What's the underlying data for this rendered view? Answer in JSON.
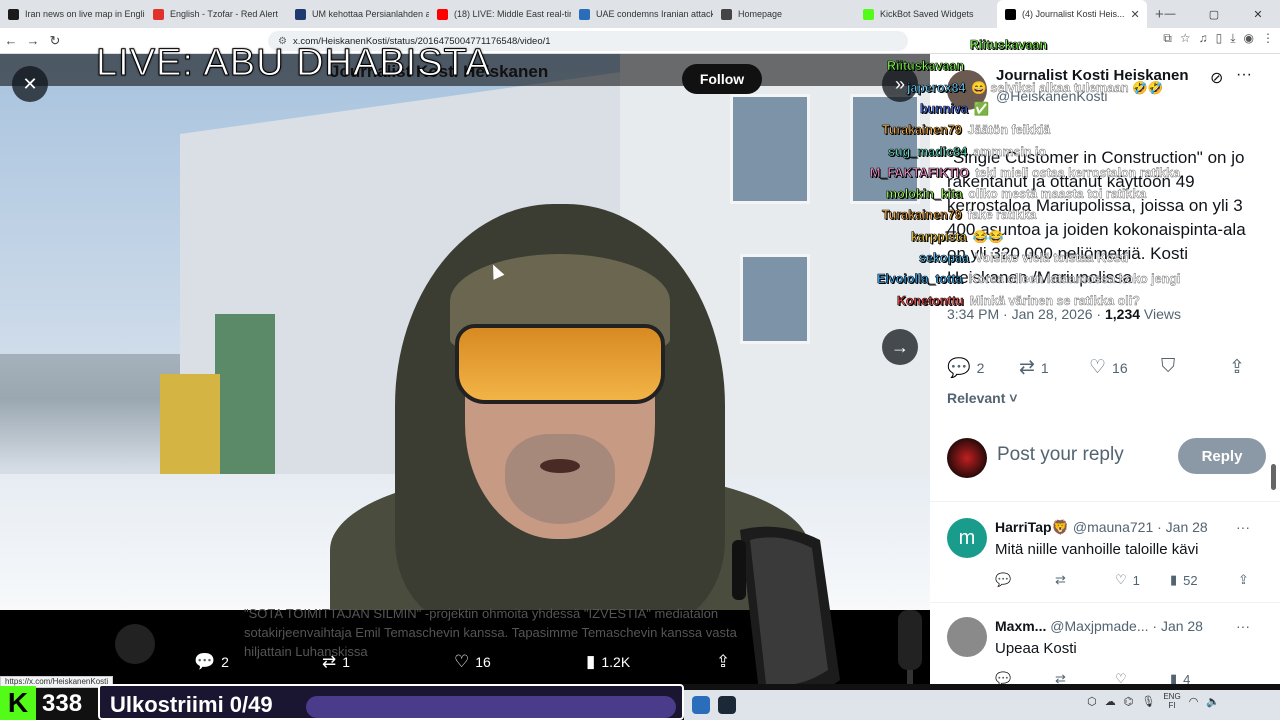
{
  "browser": {
    "tabs": [
      {
        "title": "Iran news on live map in Englis",
        "color": "#1a1a1a"
      },
      {
        "title": "English - Tzofar - Red Alert",
        "color": "#e0312c"
      },
      {
        "title": "UM kehottaa Persianlahden al...",
        "color": "#1f3a6e"
      },
      {
        "title": "(18) LIVE: Middle East real-time",
        "color": "#ff0000"
      },
      {
        "title": "UAE condemns Iranian attacks",
        "color": "#2a6ebb"
      },
      {
        "title": "Homepage",
        "color": "#444444"
      },
      {
        "title": "KickBot Saved Widgets",
        "color": "#53fc18"
      },
      {
        "title": "(4) Journalist Kosti Heis...",
        "color": "#000000"
      }
    ],
    "url": "x.com/HeiskanenKosti/status/2016475004771176548/video/1",
    "status_url": "https://x.com/HeiskanenKosti"
  },
  "video": {
    "overlay_title": "LIVE: ABU DHABISTA",
    "ghost_author": "Journalist Kosti Heiskanen",
    "ghost_follow": "Follow",
    "caption": "\"SOTA TOIMITTAJAN SILMIN\" -projektin ohmoita yhdessä \"IZVESTIA\" mediatalon sotakirjeenvaihtaja Emil Temaschevin kanssa. Tapasimme Temaschevin kanssa vasta hiljattain Luhanskissa",
    "actions": {
      "replies": "2",
      "reposts": "1",
      "likes": "16",
      "views": "1.2K"
    }
  },
  "tweet": {
    "author_name": "Journalist Kosti Heiskanen",
    "author_handle": "@HeiskanenKosti",
    "text": "\"Single Customer in Construction\" on jo rakentanut ja ottanut käyttöön 49 kerrostaloa Mariupolissa, joissa on yli 3 400 asuntoa ja joiden kokonaispinta-ala on yli 320 000 neliömetriä. Kosti Heiskanen /Mariupolissa",
    "time": "3:34 PM · Jan 28, 2026 · ",
    "views": "1,234",
    "views_label": " Views",
    "actions": {
      "replies": "2",
      "reposts": "1",
      "likes": "16"
    },
    "sort_label": "Relevant",
    "reply_placeholder": "Post your reply",
    "reply_button": "Reply"
  },
  "replies": [
    {
      "name": "HarriTap🦁",
      "handle": "@mauna721 · Jan 28",
      "text": "Mitä niille vanhoille taloille kävi",
      "avatar_letter": "m",
      "avatar_color": "#1a9c8c",
      "reposts": "",
      "likes": "1",
      "views": "52"
    },
    {
      "name": "Maxm...",
      "handle": "@Maxjpmade... · Jan 28",
      "text": "Upeaa Kosti",
      "avatar_letter": "",
      "avatar_color": "#8a8a8a",
      "reposts": "",
      "likes": "",
      "views": "4"
    }
  ],
  "chat": [
    {
      "user": "Riituskavaan",
      "msg": "",
      "color": "#7cff4a"
    },
    {
      "user": "Riituskavaan",
      "msg": "",
      "color": "#7cff4a"
    },
    {
      "user": "japerox84",
      "msg": "😄 selviksi alkaa tulemaan 🤣🤣",
      "color": "#6fd0ff"
    },
    {
      "user": "bunniva",
      "msg": "✅",
      "color": "#4f7bff"
    },
    {
      "user": "Turakainen79",
      "msg": "Jäätön feikkiä",
      "color": "#ffb347"
    },
    {
      "user": "sug_madic84",
      "msg": "ammmsin io",
      "color": "#66e0c2"
    },
    {
      "user": "M_FAKTAFIKTIO",
      "msg": "teki mieli ostaa kerrostalon ratikka",
      "color": "#ff9ad5"
    },
    {
      "user": "molokin_kita",
      "msg": "oliko mestä maasta toi ratikka",
      "color": "#9cff57"
    },
    {
      "user": "Turakainen79",
      "msg": "fake ratikka",
      "color": "#ffb347"
    },
    {
      "user": "karppista",
      "msg": "😂😂",
      "color": "#ffd84d"
    },
    {
      "user": "sekopaa",
      "msg": "Voisiko vielä toistaa Kosti",
      "color": "#5ec8ff"
    },
    {
      "user": "Elvoiolla_totta",
      "msg": "Korea olleen lataamossa koko jengi",
      "color": "#3fb3ff"
    },
    {
      "user": "Konetonttu",
      "msg": "Minkä värinen se ratikka oli?",
      "color": "#ff4a4a"
    }
  ],
  "overlay": {
    "viewers": "338",
    "goal_label": "Ulkostriimi 0/49",
    "goal_progress": 0.0,
    "k_logo": "K"
  },
  "taskbar": {
    "lang": "ENG",
    "region": "FI"
  }
}
